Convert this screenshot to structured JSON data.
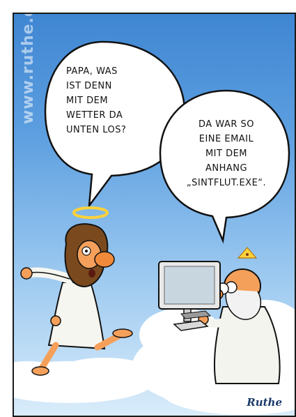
{
  "watermark": "www.ruthe.de",
  "bubble_left": {
    "text": "Papa, was\nist denn\nmit dem\nWetter da\nunten los?"
  },
  "bubble_right": {
    "text": "Da war so\neine Email\nmit dem\nAnhang\n„Sintflut.exe“."
  },
  "signature": "Ruthe",
  "colors": {
    "sky_top": "#3f86d2",
    "sky_bottom": "#d9ecfa",
    "cloud": "#ffffff",
    "halo": "#ffd23a",
    "skin": "#f5a05a",
    "hair": "#7a4a1e"
  }
}
